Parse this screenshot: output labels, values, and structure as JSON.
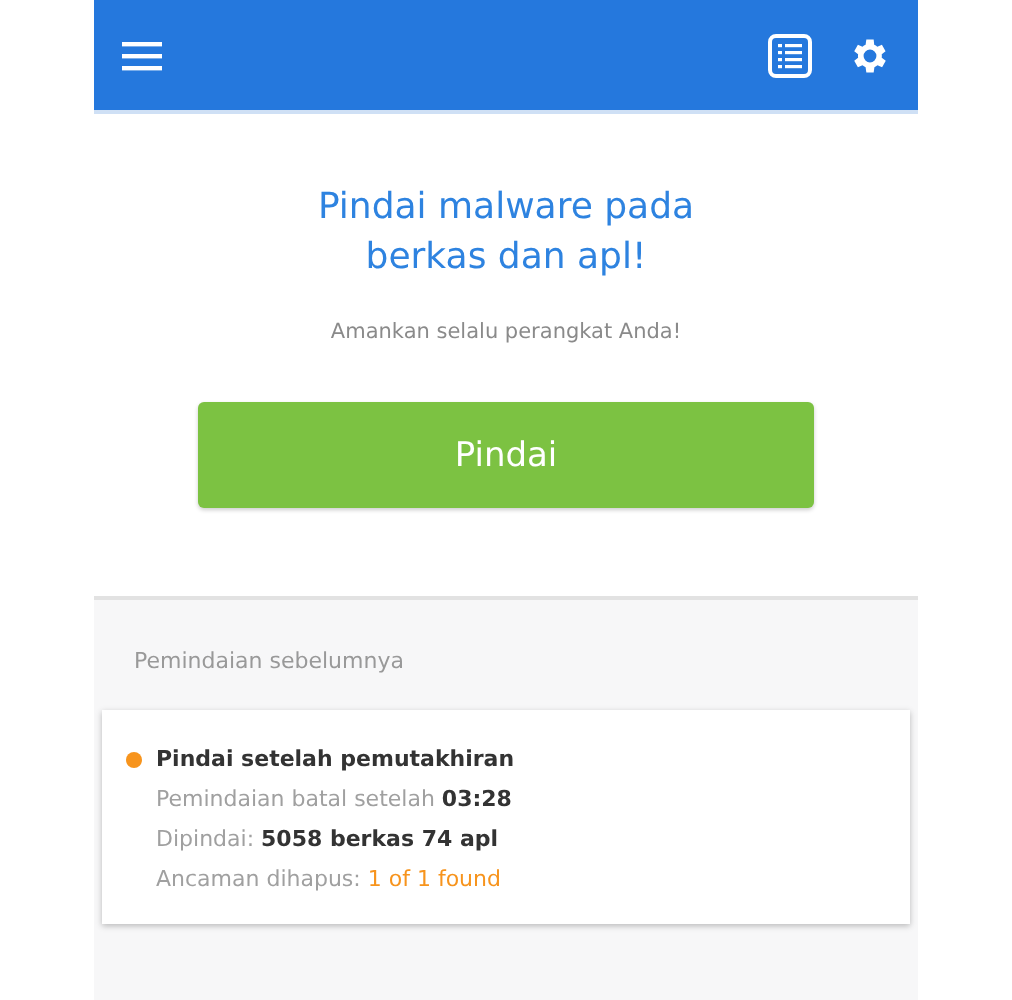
{
  "headline": [
    "Pindai malware pada",
    "berkas dan apl!"
  ],
  "subtitle": "Amankan selalu perangkat Anda!",
  "scan_button": "Pindai",
  "previous": {
    "heading": "Pemindaian sebelumnya",
    "card": {
      "title": "Pindai setelah pemutakhiran",
      "color": "#f7941d",
      "rows": [
        {
          "label": "Pemindaian batal setelah",
          "value": "03:28",
          "kind": "bold"
        },
        {
          "label": "Dipindai:",
          "value": "5058 berkas 74 apl",
          "kind": "bold"
        },
        {
          "label": "Ancaman dihapus:",
          "value": "1 of 1 found",
          "kind": "alert"
        }
      ]
    }
  }
}
